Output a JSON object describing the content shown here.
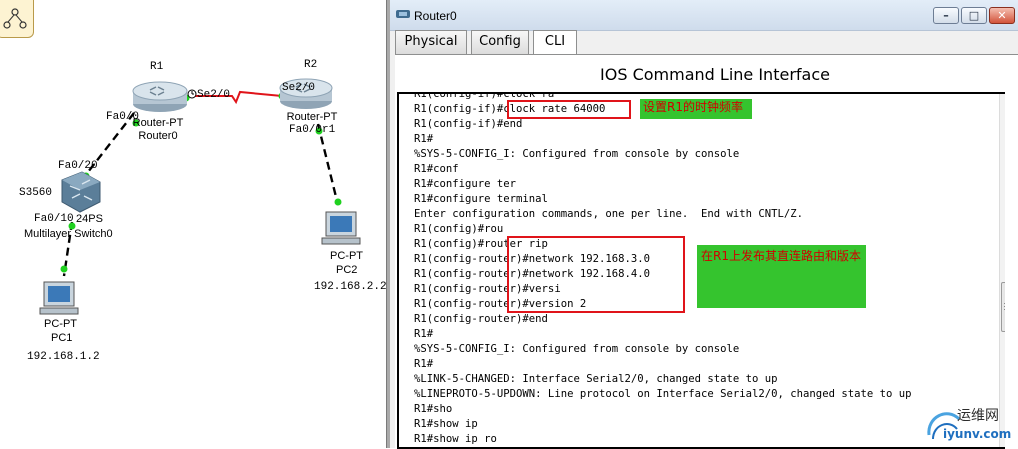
{
  "topology": {
    "devices": {
      "r1": {
        "name": "R1",
        "model": "Router-PT",
        "label": "Router0"
      },
      "r2": {
        "name": "R2",
        "model": "Router-PT",
        "label": "Fa0/0r1"
      },
      "switch": {
        "name": "S3560",
        "model": "24PS",
        "label": "Multilayer Switch0"
      },
      "pc1": {
        "model": "PC-PT",
        "label": "PC1",
        "ip": "192.168.1.2"
      },
      "pc2": {
        "model": "PC-PT",
        "label": "PC2",
        "ip": "192.168.2.2"
      }
    },
    "interfaces": {
      "r1_serial": "Se2/0",
      "r2_serial": "Se2/0",
      "r1_fa": "Fa0/0",
      "r2_fa": "Fa0/0",
      "sw_up": "Fa0/20",
      "sw_down": "Fa0/10"
    }
  },
  "window": {
    "title": "Router0",
    "tabs": [
      "Physical",
      "Config",
      "CLI"
    ],
    "active_tab": "CLI",
    "cli_heading": "IOS Command Line Interface"
  },
  "console_lines": [
    "R1(config-if)#clock ra",
    "R1(config-if)#clock rate 64000",
    "R1(config-if)#end",
    "R1#",
    "%SYS-5-CONFIG_I: Configured from console by console",
    "R1#conf",
    "R1#configure ter",
    "R1#configure terminal",
    "Enter configuration commands, one per line.  End with CNTL/Z.",
    "R1(config)#rou",
    "R1(config)#router rip",
    "R1(config-router)#network 192.168.3.0",
    "R1(config-router)#network 192.168.4.0",
    "R1(config-router)#versi",
    "R1(config-router)#version 2",
    "R1(config-router)#end",
    "R1#",
    "%SYS-5-CONFIG_I: Configured from console by console",
    "R1#",
    "%LINK-5-CHANGED: Interface Serial2/0, changed state to up",
    "%LINEPROTO-5-UPDOWN: Line protocol on Interface Serial2/0, changed state to up",
    "R1#sho",
    "R1#show ip",
    "R1#show ip ro"
  ],
  "annotations": {
    "clock_note": "设置R1的时钟频率",
    "rip_note": "在R1上发布其直连路由和版本"
  },
  "watermark": {
    "line1": "运维网",
    "line2": "iyunv.com"
  },
  "colors": {
    "annotation_box": "#e0141a",
    "note_bg": "#35c42e",
    "note_text": "#d10000",
    "serial_link": "#e0141a",
    "port_up": "#1fd11f"
  }
}
